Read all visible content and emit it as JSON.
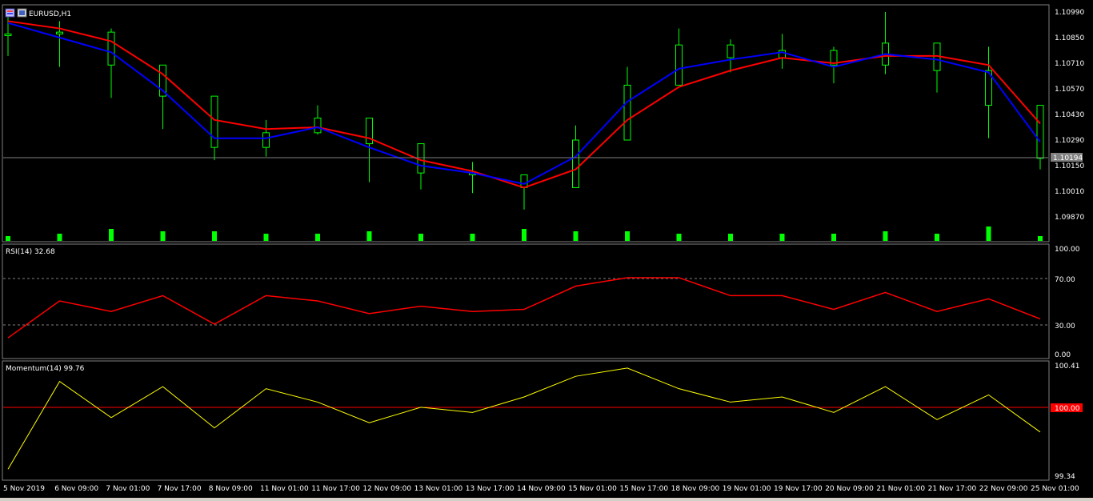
{
  "window": {
    "symbol_title": "EURUSD,H1",
    "current_price_label": "1.10194"
  },
  "colors": {
    "background": "#000000",
    "candle": "#00ff00",
    "ma_fast": "#0000ff",
    "ma_slow": "#ff0000",
    "volume": "#00ff00",
    "rsi_line": "#ff0000",
    "momentum_line": "#ffff00",
    "momentum_ref": "#ff0000",
    "grid_text": "#ffffff"
  },
  "icons": {
    "chart_window_icons": [
      "chart-window-icon",
      "chart-config-icon"
    ]
  },
  "price_panel": {
    "y_ticks": [
      "1.10990",
      "1.10850",
      "1.10710",
      "1.10570",
      "1.10430",
      "1.10290",
      "1.10150",
      "1.10010",
      "1.09870"
    ],
    "ylim": [
      1.098,
      1.11
    ]
  },
  "rsi_panel": {
    "label": "RSI(14) 32.68",
    "y_ticks": [
      "100.00",
      "70.00",
      "30.00",
      "0.00"
    ],
    "levels": [
      70,
      30
    ]
  },
  "momentum_panel": {
    "label": "Momentum(14) 99.76",
    "y_ticks": [
      "100.41",
      "99.34"
    ],
    "ref_label": "100.00",
    "ylim": [
      99.34,
      100.41
    ]
  },
  "x_axis": {
    "labels": [
      "5 Nov 2019",
      "6 Nov 09:00",
      "7 Nov 01:00",
      "7 Nov 17:00",
      "8 Nov 09:00",
      "11 Nov 01:00",
      "11 Nov 17:00",
      "12 Nov 09:00",
      "13 Nov 01:00",
      "13 Nov 17:00",
      "14 Nov 09:00",
      "15 Nov 01:00",
      "15 Nov 17:00",
      "18 Nov 09:00",
      "19 Nov 01:00",
      "19 Nov 17:00",
      "20 Nov 09:00",
      "21 Nov 01:00",
      "21 Nov 17:00",
      "22 Nov 09:00",
      "25 Nov 01:00"
    ]
  },
  "chart_data": {
    "type": "line",
    "x_labels": [
      "5 Nov 2019",
      "6 Nov 09:00",
      "7 Nov 01:00",
      "7 Nov 17:00",
      "8 Nov 09:00",
      "11 Nov 01:00",
      "11 Nov 17:00",
      "12 Nov 09:00",
      "13 Nov 01:00",
      "13 Nov 17:00",
      "14 Nov 09:00",
      "15 Nov 01:00",
      "15 Nov 17:00",
      "18 Nov 09:00",
      "19 Nov 01:00",
      "19 Nov 17:00",
      "20 Nov 09:00",
      "21 Nov 01:00",
      "21 Nov 17:00",
      "22 Nov 09:00",
      "25 Nov 01:00"
    ],
    "price_close": [
      1.1087,
      1.1088,
      1.107,
      1.1053,
      1.1025,
      1.1033,
      1.1041,
      1.1027,
      1.1011,
      1.101,
      1.1003,
      1.1029,
      1.1059,
      1.1081,
      1.1074,
      1.1078,
      1.107,
      1.1082,
      1.1067,
      1.1048,
      1.1019
    ],
    "price_high": [
      1.1099,
      1.1094,
      1.109,
      1.1061,
      1.1038,
      1.104,
      1.1048,
      1.1037,
      1.1018,
      1.1017,
      1.1009,
      1.1037,
      1.1069,
      1.109,
      1.1084,
      1.1087,
      1.108,
      1.1099,
      1.1078,
      1.108,
      1.1024
    ],
    "price_low": [
      1.1075,
      1.1069,
      1.1052,
      1.1035,
      1.1018,
      1.102,
      1.1032,
      1.1006,
      1.1002,
      1.1,
      1.0991,
      1.1019,
      1.1043,
      1.1065,
      1.1066,
      1.1068,
      1.106,
      1.1065,
      1.1055,
      1.103,
      1.1013
    ],
    "ma_fast": [
      1.1093,
      1.1085,
      1.1077,
      1.1056,
      1.103,
      1.103,
      1.1036,
      1.1025,
      1.1015,
      1.1011,
      1.1005,
      1.102,
      1.105,
      1.1068,
      1.1073,
      1.1077,
      1.1069,
      1.1076,
      1.1073,
      1.1066,
      1.1028
    ],
    "ma_slow": [
      1.1094,
      1.109,
      1.1083,
      1.1065,
      1.104,
      1.1035,
      1.1036,
      1.103,
      1.1018,
      1.1012,
      1.1003,
      1.1013,
      1.104,
      1.1058,
      1.1067,
      1.1074,
      1.1071,
      1.1075,
      1.1075,
      1.107,
      1.1038
    ],
    "volume": [
      0.2,
      0.3,
      0.5,
      0.4,
      0.4,
      0.3,
      0.3,
      0.4,
      0.3,
      0.3,
      0.5,
      0.4,
      0.4,
      0.3,
      0.3,
      0.3,
      0.3,
      0.4,
      0.3,
      0.6,
      0.2
    ],
    "rsi": [
      15,
      50,
      40,
      55,
      28,
      55,
      50,
      38,
      45,
      40,
      42,
      64,
      72,
      72,
      55,
      55,
      42,
      58,
      40,
      52,
      33
    ],
    "momentum": [
      99.4,
      100.25,
      99.9,
      100.2,
      99.8,
      100.18,
      100.05,
      99.85,
      100.0,
      99.95,
      100.1,
      100.3,
      100.38,
      100.18,
      100.05,
      100.1,
      99.95,
      100.2,
      99.88,
      100.12,
      99.76
    ],
    "ylim_price": [
      1.098,
      1.11
    ],
    "ylim_rsi": [
      0,
      100
    ],
    "ylim_momentum": [
      99.34,
      100.41
    ]
  }
}
